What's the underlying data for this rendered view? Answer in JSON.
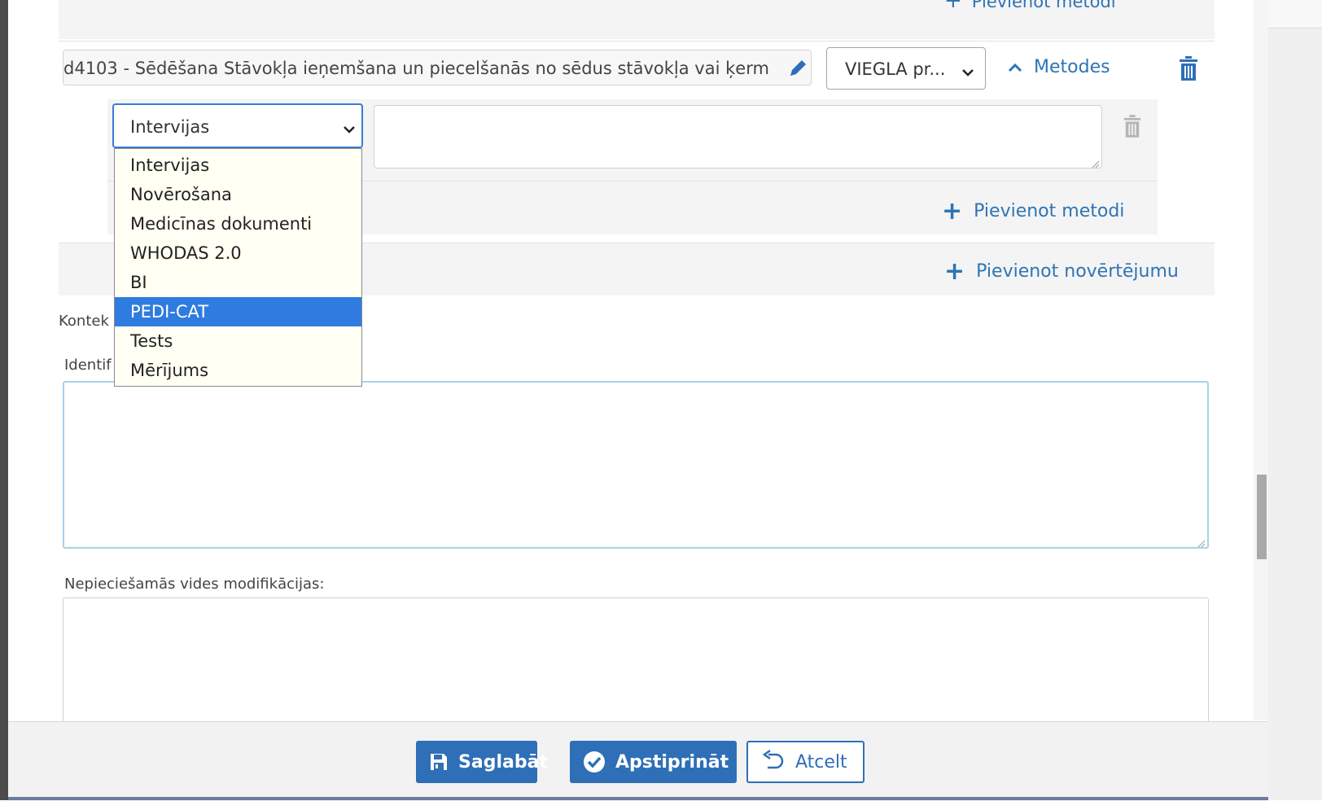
{
  "top": {
    "add_method_link": "Pievienot metodi"
  },
  "item": {
    "text": "d4103 - Sēdēšana Stāvokļa ieņemšana un piecelšanās no sēdus stāvokļa vai ķerm",
    "severity_value": "VIEGLA pr...",
    "methods_toggle": "Metodes"
  },
  "method": {
    "select_value": "Intervijas",
    "textarea_value": "",
    "options": [
      "Intervijas",
      "Novērošana",
      "Medicīnas dokumenti",
      "WHODAS 2.0",
      "BI",
      "PEDI-CAT",
      "Tests",
      "Mērījums"
    ],
    "highlighted_option": "PEDI-CAT",
    "add_method": "Pievienot metodi"
  },
  "assessment": {
    "add_assessment": "Pievienot novērtējumu"
  },
  "form": {
    "context_label": "Kontek",
    "identif_label": "Identif",
    "identif_value": "",
    "env_mod_label": "Nepieciešamās vides modifikācijas:",
    "env_mod_value": ""
  },
  "footer": {
    "save": "Saglabāt",
    "confirm": "Apstiprināt",
    "cancel": "Atcelt"
  },
  "colors": {
    "accent": "#2e6fb7",
    "link": "#2e74b5",
    "highlight": "#2f7ce0"
  }
}
